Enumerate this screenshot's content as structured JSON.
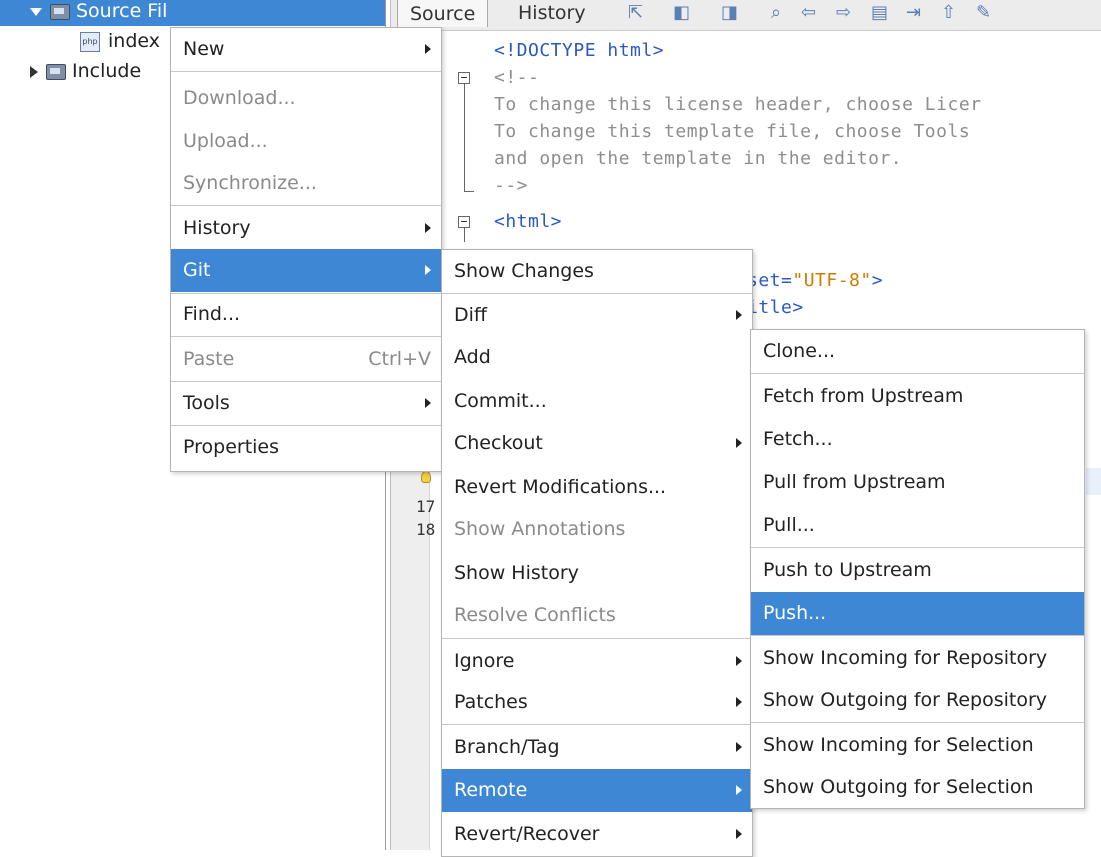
{
  "tree": {
    "source_files": "Source Fil",
    "index_file": "index",
    "include_path": "Include"
  },
  "editor": {
    "tabs": [
      "Source",
      "History"
    ],
    "code": {
      "doctype": "<!DOCTYPE html>",
      "comment_open": "<!--",
      "comment_l1": "To change this license header, choose Licer",
      "comment_l2": "To change this template file, choose Tools",
      "comment_l3": "and open the template in the editor.",
      "comment_close": "-->",
      "html_tag": "<html>",
      "charset_part1": "set=",
      "charset_value": "\"UTF-8\"",
      "charset_part2": ">",
      "title_tail": "itle>"
    },
    "line_numbers": [
      "17",
      "18"
    ]
  },
  "context_menu": {
    "items": [
      {
        "label": "New",
        "submenu": true
      },
      {
        "label": "Download...",
        "disabled": true
      },
      {
        "label": "Upload...",
        "disabled": true
      },
      {
        "label": "Synchronize...",
        "disabled": true
      },
      {
        "label": "History",
        "submenu": true
      },
      {
        "label": "Git",
        "submenu": true,
        "highlighted": true
      },
      {
        "label": "Find..."
      },
      {
        "label": "Paste",
        "disabled": true,
        "shortcut": "Ctrl+V"
      },
      {
        "label": "Tools",
        "submenu": true
      },
      {
        "label": "Properties"
      }
    ]
  },
  "git_menu": {
    "items": [
      {
        "label": "Show Changes"
      },
      {
        "label": "Diff",
        "submenu": true
      },
      {
        "label": "Add"
      },
      {
        "label": "Commit..."
      },
      {
        "label": "Checkout",
        "submenu": true
      },
      {
        "label": "Revert Modifications..."
      },
      {
        "label": "Show Annotations",
        "disabled": true
      },
      {
        "label": "Show History"
      },
      {
        "label": "Resolve Conflicts",
        "disabled": true
      },
      {
        "label": "Ignore",
        "submenu": true
      },
      {
        "label": "Patches",
        "submenu": true
      },
      {
        "label": "Branch/Tag",
        "submenu": true
      },
      {
        "label": "Remote",
        "submenu": true,
        "highlighted": true
      },
      {
        "label": "Revert/Recover",
        "submenu": true
      }
    ]
  },
  "remote_menu": {
    "items": [
      {
        "label": "Clone..."
      },
      {
        "label": "Fetch from Upstream"
      },
      {
        "label": "Fetch..."
      },
      {
        "label": "Pull from Upstream"
      },
      {
        "label": "Pull..."
      },
      {
        "label": "Push to Upstream"
      },
      {
        "label": "Push...",
        "highlighted": true
      },
      {
        "label": "Show Incoming for Repository"
      },
      {
        "label": "Show Outgoing for Repository"
      },
      {
        "label": "Show Incoming for Selection"
      },
      {
        "label": "Show Outgoing for Selection"
      }
    ]
  },
  "colors": {
    "highlight": "#3d87d5",
    "disabled_text": "#8a8a8a",
    "code_blue": "#2a58c6",
    "code_orange": "#ce7b00",
    "comment_gray": "#8e8e8e"
  }
}
